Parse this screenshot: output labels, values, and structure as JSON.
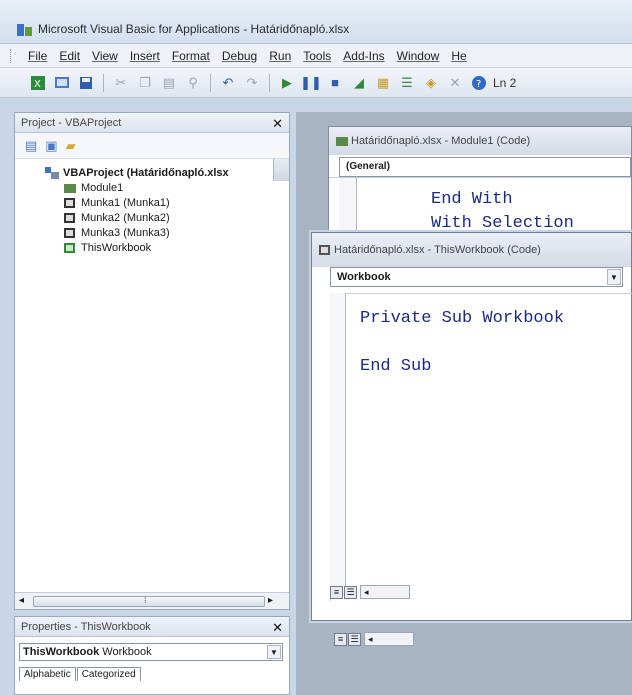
{
  "window": {
    "title": "Microsoft Visual Basic for Applications - Határidőnapló.xlsx"
  },
  "menu": [
    "File",
    "Edit",
    "View",
    "Insert",
    "Format",
    "Debug",
    "Run",
    "Tools",
    "Add-Ins",
    "Window",
    "He"
  ],
  "toolbar": {
    "position_text": "Ln 2"
  },
  "project_panel": {
    "title": "Project - VBAProject",
    "root": "VBAProject (Határidőnapló.xlsx",
    "items": [
      "Module1",
      "Munka1 (Munka1)",
      "Munka2 (Munka2)",
      "Munka3 (Munka3)",
      "ThisWorkbook"
    ]
  },
  "properties_panel": {
    "title": "Properties - ThisWorkbook",
    "object_name": "ThisWorkbook",
    "object_type": "Workbook",
    "tabs": [
      "Alphabetic",
      "Categorized"
    ]
  },
  "module_window": {
    "title": "Határidőnapló.xlsx - Module1 (Code)",
    "combo": "(General)",
    "code_lines": [
      "End With",
      "With Selection"
    ]
  },
  "workbook_window": {
    "title": "Határidőnapló.xlsx - ThisWorkbook (Code)",
    "combo": "Workbook",
    "code_lines": [
      "Private Sub Workbook",
      "End Sub"
    ]
  }
}
